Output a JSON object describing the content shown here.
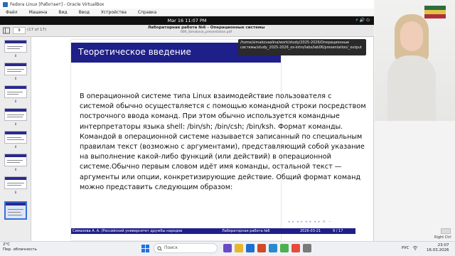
{
  "vbox": {
    "title": "Fedora Linux [Работает] - Oracle VirtualBox",
    "menu": [
      "Файл",
      "Машина",
      "Вид",
      "Ввод",
      "Устройства",
      "Справка"
    ]
  },
  "gnome": {
    "clock": "Mar 16  11:07 PM"
  },
  "viewer": {
    "page_number": "9",
    "page_of": "(17 of 17)",
    "doc_title": "Лабораторная работа №6 - Операционные системы",
    "doc_subtitle": "006_Simakova_presentation.pdf",
    "tooltip": "/home/simakovaalina/work/study/2025-2026/Операционные системы/study_2025-2026_os-intro/labs/lab06/presentation/_output"
  },
  "thumbnails": {
    "labels": [
      "8",
      "8",
      "8",
      "8",
      "8",
      "8",
      "8",
      "8",
      "8",
      "8"
    ]
  },
  "slide": {
    "title": "Теоретическое введение",
    "body": "В операционной системе типа Linux взаимодействие пользователя с системой обычно осуществляется с помощью командной строки посредством построчного ввода команд. При этом обычно используется командные интерпретаторы языка shell: /bin/sh; /bin/csh; /bin/ksh. Формат команды. Командой в операционной системе называется записанный по специальным правилам текст (возможно с аргументами), представляющий собой указание на выполнение какой-либо функций (или действий) в операционной системе.Обычно первым словом идёт имя команды, остальной текст — аргументы или опции, конкретизирующие действие. Общий формат команд можно представить следующим образом:",
    "footer_author": "Симахова А. А. (Российский университет дружбы народов",
    "footer_title": "Лабораторная работа №6",
    "footer_date": "2026-03-21",
    "footer_page": "9 / 17"
  },
  "side": {
    "right_label": "Right Ctrl"
  },
  "taskbar": {
    "temperature": "2°C",
    "weather": "Пер. облачность",
    "search_placeholder": "Поиск",
    "lang": "РУС",
    "time": "23:07",
    "date": "16.03.2026"
  },
  "colors": {
    "beamer_blue": "#1f1f8a",
    "selection": "#3a6fd8"
  }
}
